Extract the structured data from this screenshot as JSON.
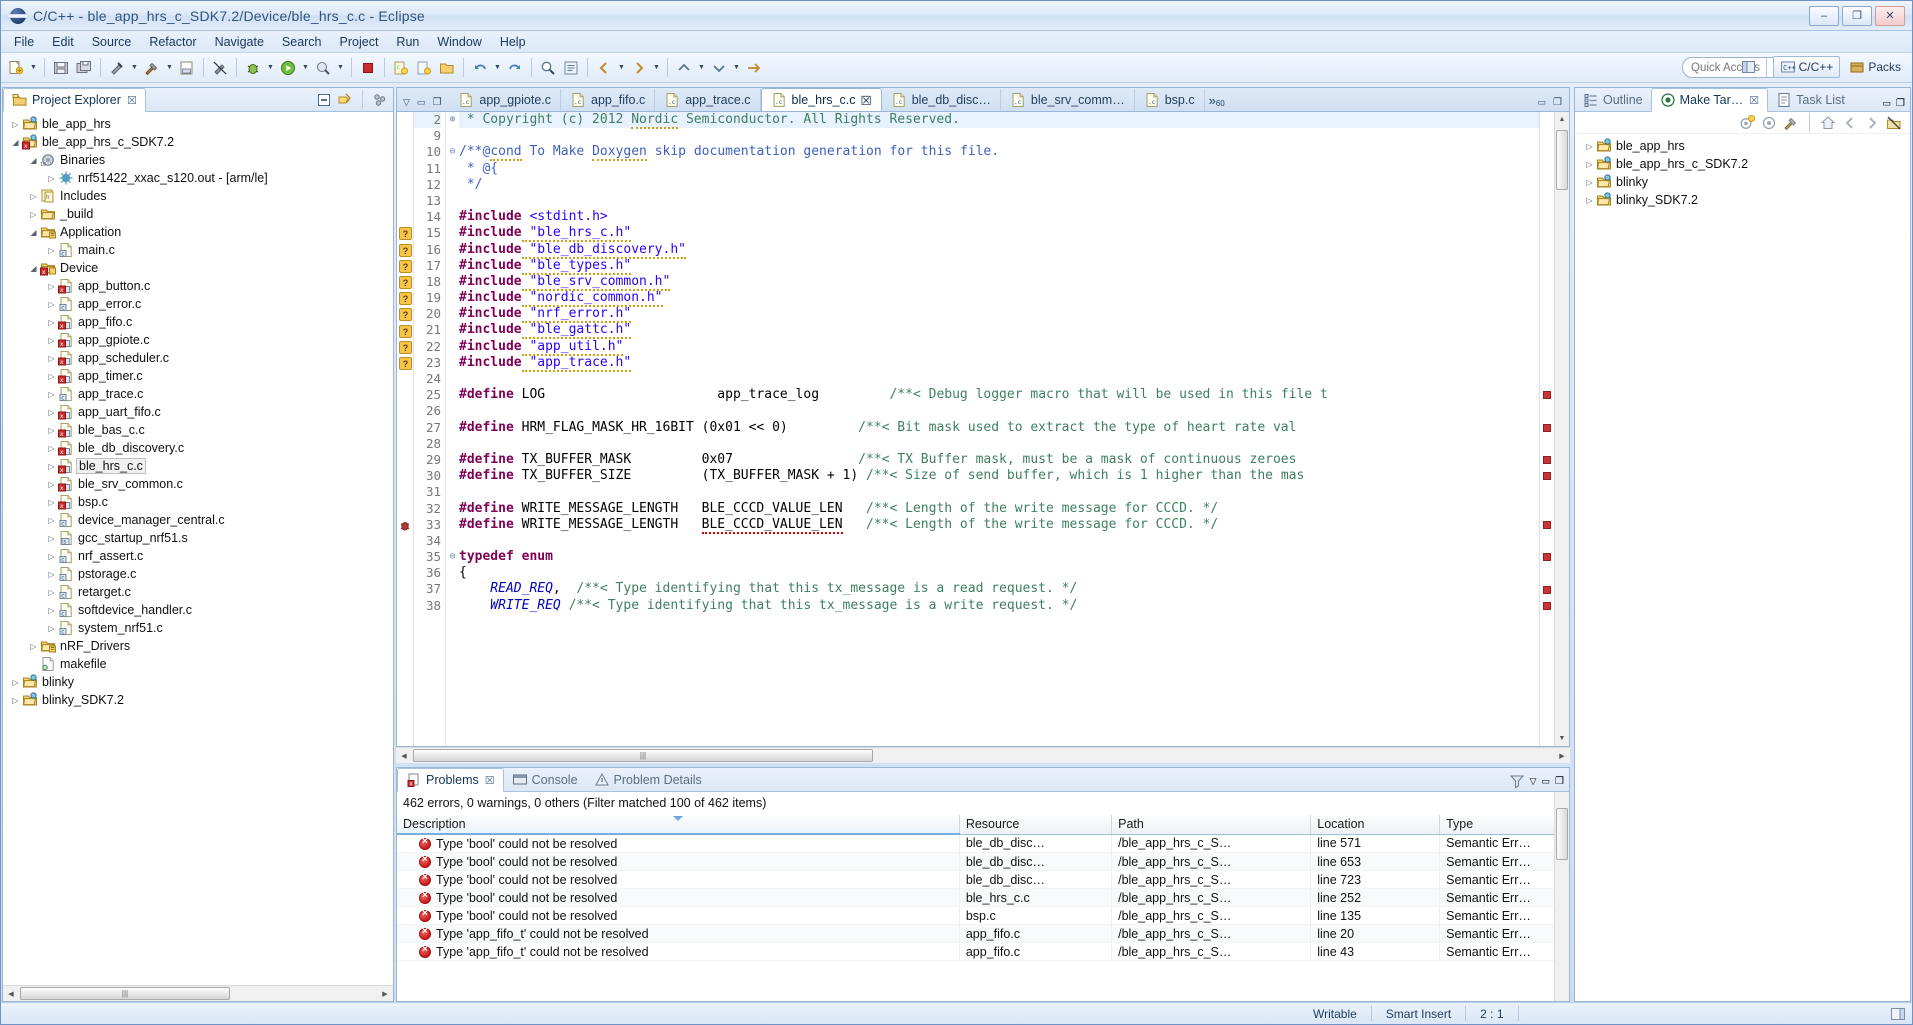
{
  "window": {
    "title": "C/C++ - ble_app_hrs_c_SDK7.2/Device/ble_hrs_c.c - Eclipse",
    "minimize": "–",
    "maximize": "❐",
    "close": "✕"
  },
  "menu": [
    "File",
    "Edit",
    "Source",
    "Refactor",
    "Navigate",
    "Search",
    "Project",
    "Run",
    "Window",
    "Help"
  ],
  "toolbar": {
    "quick_access_placeholder": "Quick Access",
    "perspectives": [
      {
        "label": "C/C++",
        "icon": "cpp-perspective-icon",
        "active": true
      },
      {
        "label": "Packs",
        "icon": "packs-perspective-icon",
        "active": false
      }
    ]
  },
  "project_explorer": {
    "tab_label": "Project Explorer",
    "close_glyph": "☒",
    "tree": [
      {
        "depth": 0,
        "twist": "▷",
        "icon": "project-icon",
        "label": "ble_app_hrs"
      },
      {
        "depth": 0,
        "twist": "◢",
        "icon": "project-error-icon",
        "label": "ble_app_hrs_c_SDK7.2"
      },
      {
        "depth": 1,
        "twist": "◢",
        "icon": "binaries-icon",
        "label": "Binaries"
      },
      {
        "depth": 2,
        "twist": "▷",
        "icon": "executable-icon",
        "label": "nrf51422_xxac_s120.out - [arm/le]"
      },
      {
        "depth": 1,
        "twist": "▷",
        "icon": "includes-icon",
        "label": "Includes"
      },
      {
        "depth": 1,
        "twist": "▷",
        "icon": "folder-icon",
        "label": "_build"
      },
      {
        "depth": 1,
        "twist": "◢",
        "icon": "source-folder-icon",
        "label": "Application"
      },
      {
        "depth": 2,
        "twist": "▷",
        "icon": "c-file-icon",
        "label": "main.c"
      },
      {
        "depth": 1,
        "twist": "◢",
        "icon": "source-folder-error-icon",
        "label": "Device"
      },
      {
        "depth": 2,
        "twist": "▷",
        "icon": "c-file-error-icon",
        "label": "app_button.c"
      },
      {
        "depth": 2,
        "twist": "▷",
        "icon": "c-file-icon",
        "label": "app_error.c"
      },
      {
        "depth": 2,
        "twist": "▷",
        "icon": "c-file-error-icon",
        "label": "app_fifo.c"
      },
      {
        "depth": 2,
        "twist": "▷",
        "icon": "c-file-error-icon",
        "label": "app_gpiote.c"
      },
      {
        "depth": 2,
        "twist": "▷",
        "icon": "c-file-error-icon",
        "label": "app_scheduler.c"
      },
      {
        "depth": 2,
        "twist": "▷",
        "icon": "c-file-error-icon",
        "label": "app_timer.c"
      },
      {
        "depth": 2,
        "twist": "▷",
        "icon": "c-file-icon",
        "label": "app_trace.c"
      },
      {
        "depth": 2,
        "twist": "▷",
        "icon": "c-file-error-icon",
        "label": "app_uart_fifo.c"
      },
      {
        "depth": 2,
        "twist": "▷",
        "icon": "c-file-error-icon",
        "label": "ble_bas_c.c"
      },
      {
        "depth": 2,
        "twist": "▷",
        "icon": "c-file-error-icon",
        "label": "ble_db_discovery.c"
      },
      {
        "depth": 2,
        "twist": "▷",
        "icon": "c-file-error-icon",
        "label": "ble_hrs_c.c",
        "selected": true
      },
      {
        "depth": 2,
        "twist": "▷",
        "icon": "c-file-error-icon",
        "label": "ble_srv_common.c"
      },
      {
        "depth": 2,
        "twist": "▷",
        "icon": "c-file-error-icon",
        "label": "bsp.c"
      },
      {
        "depth": 2,
        "twist": "▷",
        "icon": "c-file-icon",
        "label": "device_manager_central.c"
      },
      {
        "depth": 2,
        "twist": "▷",
        "icon": "asm-file-icon",
        "label": "gcc_startup_nrf51.s"
      },
      {
        "depth": 2,
        "twist": "▷",
        "icon": "c-file-icon",
        "label": "nrf_assert.c"
      },
      {
        "depth": 2,
        "twist": "▷",
        "icon": "c-file-icon",
        "label": "pstorage.c"
      },
      {
        "depth": 2,
        "twist": "▷",
        "icon": "c-file-icon",
        "label": "retarget.c"
      },
      {
        "depth": 2,
        "twist": "▷",
        "icon": "c-file-icon",
        "label": "softdevice_handler.c"
      },
      {
        "depth": 2,
        "twist": "▷",
        "icon": "c-file-icon",
        "label": "system_nrf51.c"
      },
      {
        "depth": 1,
        "twist": "▷",
        "icon": "source-folder-icon",
        "label": "nRF_Drivers"
      },
      {
        "depth": 1,
        "twist": "",
        "icon": "makefile-icon",
        "label": "makefile"
      },
      {
        "depth": 0,
        "twist": "▷",
        "icon": "project-icon",
        "label": "blinky"
      },
      {
        "depth": 0,
        "twist": "▷",
        "icon": "project-icon",
        "label": "blinky_SDK7.2"
      }
    ]
  },
  "editor": {
    "tabs": [
      {
        "label": "app_gpiote.c",
        "active": false
      },
      {
        "label": "app_fifo.c",
        "active": false
      },
      {
        "label": "app_trace.c",
        "active": false
      },
      {
        "label": "ble_hrs_c.c",
        "active": true,
        "close_glyph": "☒"
      },
      {
        "label": "ble_db_disc…",
        "active": false
      },
      {
        "label": "ble_srv_comm…",
        "active": false
      },
      {
        "label": "bsp.c",
        "active": false
      }
    ],
    "more_tabs_glyph": "»",
    "more_tabs_count": "60",
    "lines": [
      {
        "num": "2",
        "fold": "⊕",
        "marker": "",
        "highlight": true,
        "tokens": [
          {
            "t": "cmt",
            "v": " * Copyright (c) 2012 "
          },
          {
            "t": "cmt sq-warn",
            "v": "Nordic"
          },
          {
            "t": "cmt",
            "v": " Semiconductor. All Rights Reserved."
          },
          {
            "t": "caret",
            "v": ""
          }
        ]
      },
      {
        "num": "9",
        "fold": "",
        "marker": "",
        "tokens": []
      },
      {
        "num": "10",
        "fold": "⊖",
        "marker": "",
        "tokens": [
          {
            "t": "doc",
            "v": "/**@"
          },
          {
            "t": "doc sq-warn",
            "v": "cond"
          },
          {
            "t": "doc",
            "v": " To Make "
          },
          {
            "t": "doc sq-warn",
            "v": "Doxygen"
          },
          {
            "t": "doc",
            "v": " skip documentation generation for this file."
          }
        ]
      },
      {
        "num": "11",
        "fold": "",
        "marker": "",
        "tokens": [
          {
            "t": "doc",
            "v": " * @{"
          }
        ]
      },
      {
        "num": "12",
        "fold": "",
        "marker": "",
        "tokens": [
          {
            "t": "doc",
            "v": " */"
          }
        ]
      },
      {
        "num": "13",
        "fold": "",
        "marker": "",
        "tokens": []
      },
      {
        "num": "14",
        "fold": "",
        "marker": "",
        "tokens": [
          {
            "t": "pp",
            "v": "#include"
          },
          {
            "t": "str",
            "v": " <stdint.h>"
          }
        ]
      },
      {
        "num": "15",
        "fold": "",
        "marker": "warn",
        "tokens": [
          {
            "t": "pp",
            "v": "#include"
          },
          {
            "t": "str sq-warn",
            "v": " \"ble_hrs_c.h\""
          }
        ]
      },
      {
        "num": "16",
        "fold": "",
        "marker": "warn",
        "tokens": [
          {
            "t": "pp",
            "v": "#include"
          },
          {
            "t": "str sq-warn",
            "v": " \"ble_db_discovery.h\""
          }
        ]
      },
      {
        "num": "17",
        "fold": "",
        "marker": "warn",
        "tokens": [
          {
            "t": "pp",
            "v": "#include"
          },
          {
            "t": "str sq-warn",
            "v": " \"ble_types.h\""
          }
        ]
      },
      {
        "num": "18",
        "fold": "",
        "marker": "warn",
        "tokens": [
          {
            "t": "pp",
            "v": "#include"
          },
          {
            "t": "str sq-warn",
            "v": " \"ble_srv_common.h\""
          }
        ]
      },
      {
        "num": "19",
        "fold": "",
        "marker": "warn",
        "tokens": [
          {
            "t": "pp",
            "v": "#include"
          },
          {
            "t": "str sq-warn",
            "v": " \"nordic_common.h\""
          }
        ]
      },
      {
        "num": "20",
        "fold": "",
        "marker": "warn",
        "tokens": [
          {
            "t": "pp",
            "v": "#include"
          },
          {
            "t": "str sq-warn",
            "v": " \"nrf_error.h\""
          }
        ]
      },
      {
        "num": "21",
        "fold": "",
        "marker": "warn",
        "tokens": [
          {
            "t": "pp",
            "v": "#include"
          },
          {
            "t": "str sq-warn",
            "v": " \"ble_gattc.h\""
          }
        ]
      },
      {
        "num": "22",
        "fold": "",
        "marker": "warn",
        "tokens": [
          {
            "t": "pp",
            "v": "#include"
          },
          {
            "t": "str sq-warn",
            "v": " \"app_util.h\""
          }
        ]
      },
      {
        "num": "23",
        "fold": "",
        "marker": "warn",
        "tokens": [
          {
            "t": "pp",
            "v": "#include"
          },
          {
            "t": "str sq-warn",
            "v": " \"app_trace.h\""
          }
        ]
      },
      {
        "num": "24",
        "fold": "",
        "marker": "",
        "tokens": []
      },
      {
        "num": "25",
        "fold": "",
        "marker": "",
        "rulerRed": true,
        "tokens": [
          {
            "t": "pp",
            "v": "#define"
          },
          {
            "t": "id",
            "v": " LOG                      app_trace_log         "
          },
          {
            "t": "cmt",
            "v": "/**< Debug logger macro that will be used in this file t"
          }
        ]
      },
      {
        "num": "26",
        "fold": "",
        "marker": "",
        "tokens": []
      },
      {
        "num": "27",
        "fold": "",
        "marker": "",
        "rulerRed": true,
        "tokens": [
          {
            "t": "pp",
            "v": "#define"
          },
          {
            "t": "id",
            "v": " HRM_FLAG_MASK_HR_16BIT (0x01 << 0)         "
          },
          {
            "t": "cmt",
            "v": "/**< Bit mask used to extract the type of heart rate val"
          }
        ]
      },
      {
        "num": "28",
        "fold": "",
        "marker": "",
        "tokens": []
      },
      {
        "num": "29",
        "fold": "",
        "marker": "",
        "rulerRed": true,
        "tokens": [
          {
            "t": "pp",
            "v": "#define"
          },
          {
            "t": "id",
            "v": " TX_BUFFER_MASK         0x07                "
          },
          {
            "t": "cmt",
            "v": "/**< TX Buffer mask, must be a mask of continuous zeroes"
          }
        ]
      },
      {
        "num": "30",
        "fold": "",
        "marker": "",
        "rulerRed": true,
        "tokens": [
          {
            "t": "pp",
            "v": "#define"
          },
          {
            "t": "id",
            "v": " TX_BUFFER_SIZE         (TX_BUFFER_MASK + 1) "
          },
          {
            "t": "cmt",
            "v": "/**< Size of send buffer, which is 1 higher than the mas"
          }
        ]
      },
      {
        "num": "31",
        "fold": "",
        "marker": "",
        "tokens": []
      },
      {
        "num": "32",
        "fold": "",
        "marker": "",
        "tokens": [
          {
            "t": "pp",
            "v": "#define"
          },
          {
            "t": "id",
            "v": " WRITE_MESSAGE_LENGTH   BLE_CCCD_VALUE_LEN   "
          },
          {
            "t": "cmt",
            "v": "/**< Length of the write message for CCCD. */"
          }
        ]
      },
      {
        "num": "33",
        "fold": "",
        "marker": "bug",
        "tokens": [
          {
            "t": "pp",
            "v": "#define"
          },
          {
            "t": "id",
            "v": " WRITE_MESSAGE_LENGTH   "
          },
          {
            "t": "id sq-err",
            "v": "BLE_CCCD_VALUE_LEN"
          },
          {
            "t": "id",
            "v": "   "
          },
          {
            "t": "cmt",
            "v": "/**< Length of the write message for CCCD. */"
          }
        ]
      },
      {
        "num": "34",
        "fold": "",
        "marker": "",
        "tokens": []
      },
      {
        "num": "35",
        "fold": "⊖",
        "marker": "",
        "rulerRed": true,
        "tokens": [
          {
            "t": "kw",
            "v": "typedef enum"
          }
        ]
      },
      {
        "num": "36",
        "fold": "",
        "marker": "",
        "tokens": [
          {
            "t": "id",
            "v": "{"
          }
        ]
      },
      {
        "num": "37",
        "fold": "",
        "marker": "",
        "rulerRed": true,
        "tokens": [
          {
            "t": "ital",
            "v": "    READ_REQ"
          },
          {
            "t": "id",
            "v": ",  "
          },
          {
            "t": "cmt",
            "v": "/**< Type identifying that this tx_message is a read request. */"
          }
        ]
      },
      {
        "num": "38",
        "fold": "",
        "marker": "",
        "rulerRed": true,
        "tokens": [
          {
            "t": "ital",
            "v": "    WRITE_REQ"
          },
          {
            "t": "id",
            "v": " "
          },
          {
            "t": "cmt",
            "v": "/**< Type identifying that this tx_message is a write request. */"
          }
        ]
      }
    ]
  },
  "problems": {
    "tabs": [
      {
        "label": "Problems",
        "icon": "problems-icon",
        "active": true,
        "close_glyph": "☒"
      },
      {
        "label": "Console",
        "icon": "console-icon",
        "active": false
      },
      {
        "label": "Problem Details",
        "icon": "problem-details-icon",
        "active": false
      }
    ],
    "summary": "462 errors, 0 warnings, 0 others (Filter matched 100 of 462 items)",
    "columns": [
      "Description",
      "Resource",
      "Path",
      "Location",
      "Type"
    ],
    "sorted_column": "Description",
    "rows": [
      {
        "description": "Type 'bool' could not be resolved",
        "resource": "ble_db_disc…",
        "path": "/ble_app_hrs_c_S…",
        "location": "line 571",
        "type": "Semantic Err…"
      },
      {
        "description": "Type 'bool' could not be resolved",
        "resource": "ble_db_disc…",
        "path": "/ble_app_hrs_c_S…",
        "location": "line 653",
        "type": "Semantic Err…"
      },
      {
        "description": "Type 'bool' could not be resolved",
        "resource": "ble_db_disc…",
        "path": "/ble_app_hrs_c_S…",
        "location": "line 723",
        "type": "Semantic Err…"
      },
      {
        "description": "Type 'bool' could not be resolved",
        "resource": "ble_hrs_c.c",
        "path": "/ble_app_hrs_c_S…",
        "location": "line 252",
        "type": "Semantic Err…"
      },
      {
        "description": "Type 'bool' could not be resolved",
        "resource": "bsp.c",
        "path": "/ble_app_hrs_c_S…",
        "location": "line 135",
        "type": "Semantic Err…"
      },
      {
        "description": "Type 'app_fifo_t' could not be resolved",
        "resource": "app_fifo.c",
        "path": "/ble_app_hrs_c_S…",
        "location": "line 20",
        "type": "Semantic Err…"
      },
      {
        "description": "Type 'app_fifo_t' could not be resolved",
        "resource": "app_fifo.c",
        "path": "/ble_app_hrs_c_S…",
        "location": "line 43",
        "type": "Semantic Err…"
      }
    ]
  },
  "right_panel": {
    "tabs": [
      {
        "label": "Outline",
        "icon": "outline-icon",
        "active": false
      },
      {
        "label": "Make Tar…",
        "icon": "make-target-icon",
        "active": true,
        "close_glyph": "☒"
      },
      {
        "label": "Task List",
        "icon": "task-list-icon",
        "active": false
      }
    ],
    "tree": [
      {
        "twist": "▷",
        "icon": "project-icon",
        "label": "ble_app_hrs"
      },
      {
        "twist": "▷",
        "icon": "project-icon",
        "label": "ble_app_hrs_c_SDK7.2"
      },
      {
        "twist": "▷",
        "icon": "project-icon",
        "label": "blinky"
      },
      {
        "twist": "▷",
        "icon": "project-icon",
        "label": "blinky_SDK7.2"
      }
    ]
  },
  "statusbar": {
    "writable": "Writable",
    "insert_mode": "Smart Insert",
    "position": "2 : 1"
  }
}
